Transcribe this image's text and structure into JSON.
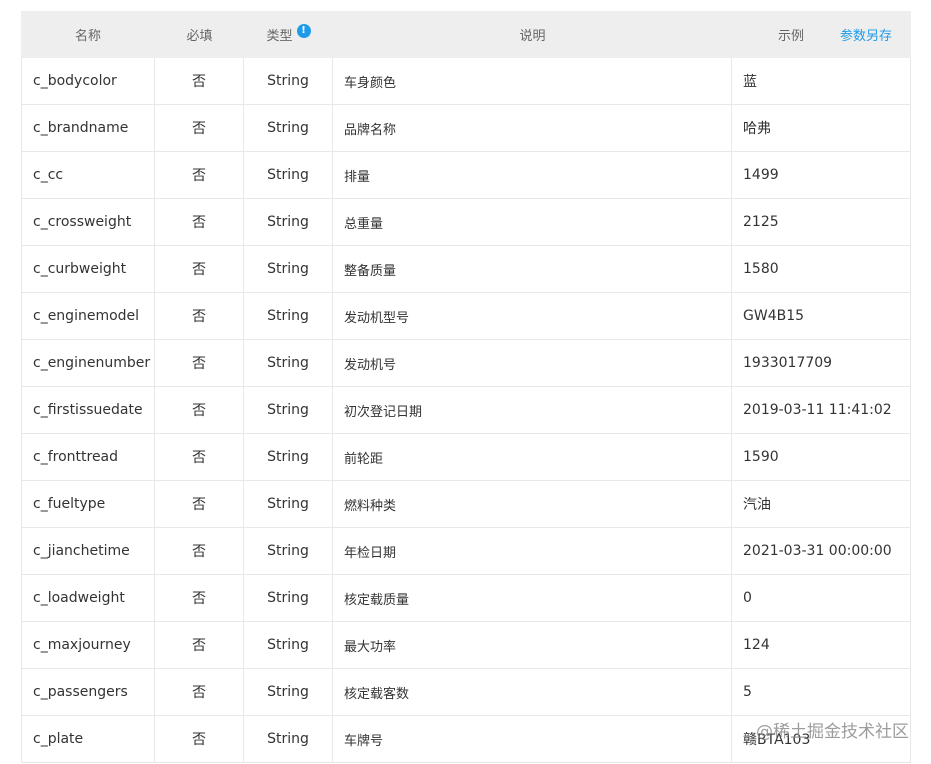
{
  "header": {
    "name": "名称",
    "required": "必填",
    "type": "类型",
    "description": "说明",
    "example": "示例",
    "save_params": "参数另存"
  },
  "rows": [
    {
      "name": "c_bodycolor",
      "required": "否",
      "type": "String",
      "description": "车身颜色",
      "example": "蓝"
    },
    {
      "name": "c_brandname",
      "required": "否",
      "type": "String",
      "description": "品牌名称",
      "example": "哈弗"
    },
    {
      "name": "c_cc",
      "required": "否",
      "type": "String",
      "description": "排量",
      "example": "1499"
    },
    {
      "name": "c_crossweight",
      "required": "否",
      "type": "String",
      "description": "总重量",
      "example": "2125"
    },
    {
      "name": "c_curbweight",
      "required": "否",
      "type": "String",
      "description": "整备质量",
      "example": "1580"
    },
    {
      "name": "c_enginemodel",
      "required": "否",
      "type": "String",
      "description": "发动机型号",
      "example": "GW4B15"
    },
    {
      "name": "c_enginenumber",
      "required": "否",
      "type": "String",
      "description": "发动机号",
      "example": "1933017709"
    },
    {
      "name": "c_firstissuedate",
      "required": "否",
      "type": "String",
      "description": "初次登记日期",
      "example": "2019-03-11 11:41:02"
    },
    {
      "name": "c_fronttread",
      "required": "否",
      "type": "String",
      "description": "前轮距",
      "example": "1590"
    },
    {
      "name": "c_fueltype",
      "required": "否",
      "type": "String",
      "description": "燃料种类",
      "example": "汽油"
    },
    {
      "name": "c_jianchetime",
      "required": "否",
      "type": "String",
      "description": "年检日期",
      "example": "2021-03-31 00:00:00"
    },
    {
      "name": "c_loadweight",
      "required": "否",
      "type": "String",
      "description": "核定载质量",
      "example": "0"
    },
    {
      "name": "c_maxjourney",
      "required": "否",
      "type": "String",
      "description": "最大功率",
      "example": "124"
    },
    {
      "name": "c_passengers",
      "required": "否",
      "type": "String",
      "description": "核定载客数",
      "example": "5"
    },
    {
      "name": "c_plate",
      "required": "否",
      "type": "String",
      "description": "车牌号",
      "example": "赣BTA103"
    }
  ],
  "watermark": "@稀土掘金技术社区",
  "info_icon": "info-icon",
  "colors": {
    "accent": "#1e9be9",
    "header_bg": "#eeeeee",
    "border": "#e8e8e8"
  }
}
